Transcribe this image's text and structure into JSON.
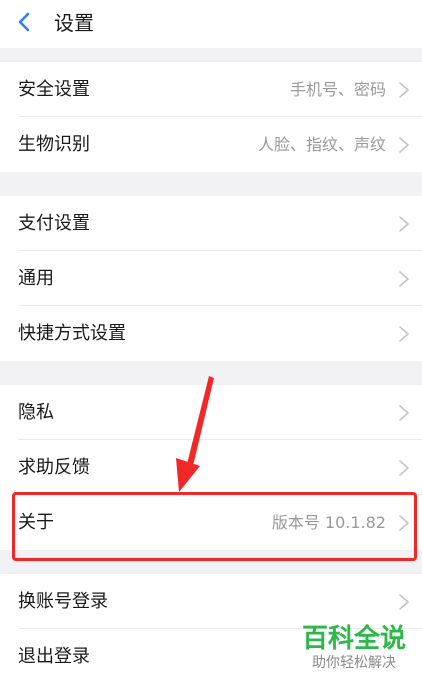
{
  "header": {
    "title": "设置",
    "back_icon": "chevron-left-icon"
  },
  "colors": {
    "accent": "#2f7ff0",
    "annotation": "#f02828",
    "watermark": "#2eb84a"
  },
  "groups": [
    {
      "items": [
        {
          "label": "安全设置",
          "detail": "手机号、密码",
          "icon": "chevron-right-icon"
        },
        {
          "label": "生物识别",
          "detail": "人脸、指纹、声纹",
          "icon": "chevron-right-icon"
        }
      ]
    },
    {
      "items": [
        {
          "label": "支付设置",
          "detail": "",
          "icon": "chevron-right-icon"
        },
        {
          "label": "通用",
          "detail": "",
          "icon": "chevron-right-icon"
        },
        {
          "label": "快捷方式设置",
          "detail": "",
          "icon": "chevron-right-icon"
        }
      ]
    },
    {
      "items": [
        {
          "label": "隐私",
          "detail": "",
          "icon": "chevron-right-icon"
        },
        {
          "label": "求助反馈",
          "detail": "",
          "icon": "chevron-right-icon"
        },
        {
          "label": "关于",
          "detail": "版本号 10.1.82",
          "icon": "chevron-right-icon"
        }
      ]
    },
    {
      "items": [
        {
          "label": "换账号登录",
          "detail": "",
          "icon": "chevron-right-icon"
        },
        {
          "label": "退出登录",
          "detail": "",
          "icon": "chevron-right-icon"
        }
      ]
    }
  ],
  "watermark": {
    "title": "百科全说",
    "subtitle": "助你轻松解决"
  }
}
